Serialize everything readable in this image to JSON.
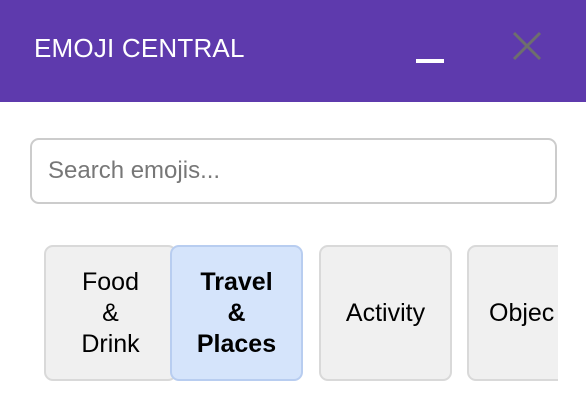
{
  "header": {
    "title": "EMOJI CENTRAL",
    "background_color": "#5e3aad",
    "minimize_icon": "minimize-icon",
    "close_icon": "close-icon"
  },
  "search": {
    "placeholder": "Search emojis...",
    "value": ""
  },
  "categories": [
    {
      "label": "Food\n&\nDrink",
      "active": false
    },
    {
      "label": "Travel\n&\nPlaces",
      "active": true
    },
    {
      "label": "Activity",
      "active": false
    },
    {
      "label": "Objec",
      "active": false
    }
  ],
  "colors": {
    "tab_background": "#f0f0f0",
    "tab_active_background": "#d5e4fb"
  }
}
